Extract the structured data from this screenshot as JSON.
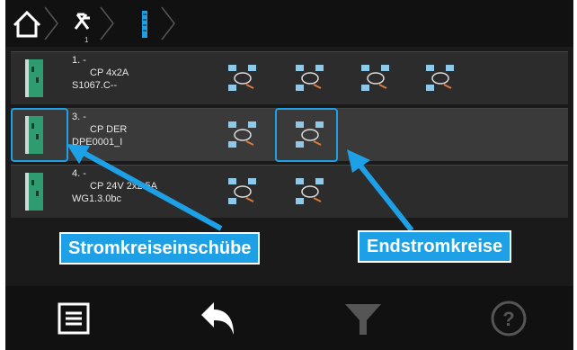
{
  "breadcrumb": {
    "items": [
      {
        "icon": "home-icon"
      },
      {
        "icon": "no-power-icon",
        "sub": "1"
      },
      {
        "icon": "card-slot-icon"
      }
    ]
  },
  "rows": [
    {
      "num": "1. -",
      "name": "CP 4x2A",
      "code": "S1067.C--",
      "circuits": 4,
      "selected": false
    },
    {
      "num": "3. -",
      "name": "CP DER",
      "code": "DPE0001_I",
      "circuits": 2,
      "selected": true
    },
    {
      "num": "4. -",
      "name": "CP 24V 2x2.5A",
      "code": "WG1.3.0bc",
      "circuits": 2,
      "selected": false
    }
  ],
  "annotations": {
    "left_label": "Stromkreiseinschübe",
    "right_label": "Endstromkreise"
  },
  "bottombar": {
    "icons": [
      "menu-icon",
      "back-icon",
      "filter-icon",
      "help-icon"
    ]
  },
  "colors": {
    "accent": "#1ea0e6",
    "card_green": "#2e9c6e"
  }
}
